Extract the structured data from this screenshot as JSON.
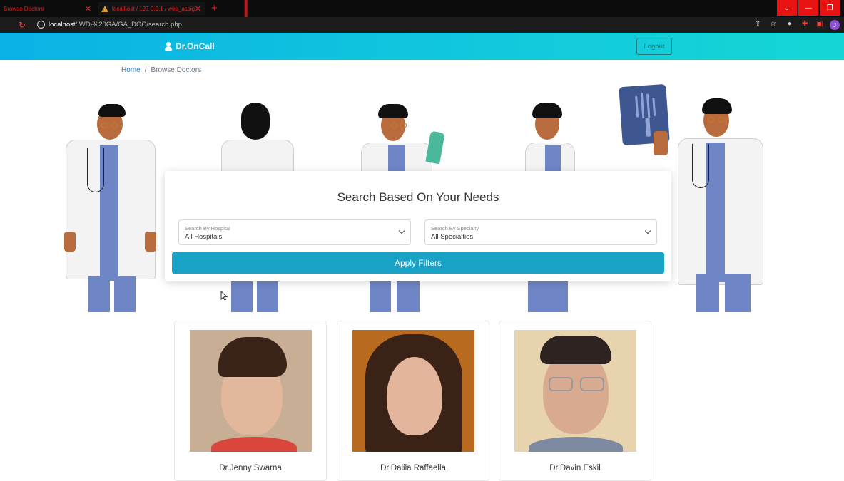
{
  "browser": {
    "tabs": [
      {
        "title": "Browse Doctors"
      },
      {
        "title": "localhost / 127.0.0.1 / web_assig"
      }
    ],
    "url_host": "localhost",
    "url_path": "/IWD-%20GA/GA_DOC/search.php"
  },
  "navbar": {
    "brand": "Dr.OnCall",
    "logout_label": "Logout"
  },
  "breadcrumb": {
    "home": "Home",
    "separator": "/",
    "current": "Browse Doctors"
  },
  "search": {
    "title": "Search Based On Your Needs",
    "hospital_label": "Search By Hospital",
    "hospital_value": "All Hospitals",
    "specialty_label": "Search By Specialty",
    "specialty_value": "All Specialties",
    "apply_label": "Apply Filters"
  },
  "doctors": [
    {
      "name": "Dr.Jenny Swarna"
    },
    {
      "name": "Dr.Dalila Raffaella"
    },
    {
      "name": "Dr.Davin Eskil"
    }
  ],
  "colors": {
    "navbar_start": "#0bb2e4",
    "navbar_end": "#15d6d6",
    "apply_button": "#17a2c6",
    "scrubs": "#6f86c6"
  }
}
